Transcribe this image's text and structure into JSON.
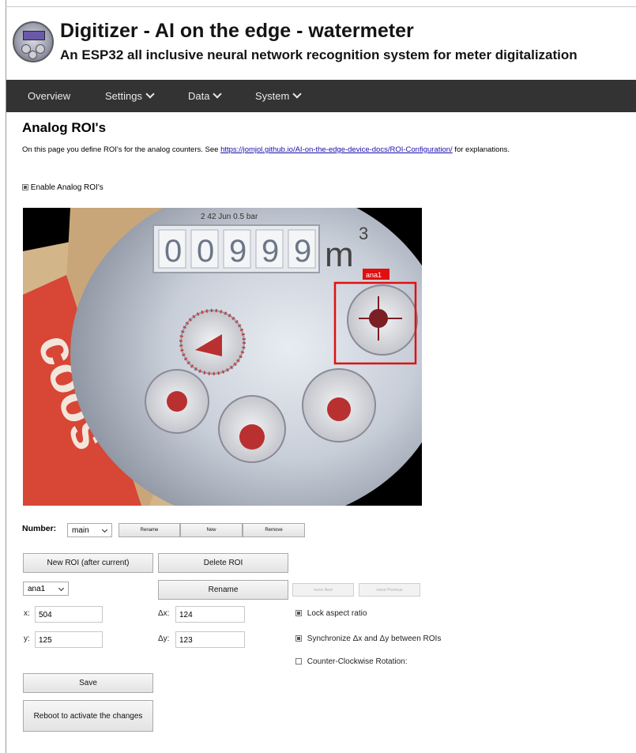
{
  "header": {
    "title": "Digitizer - AI on the edge - watermeter",
    "subtitle": "An ESP32 all inclusive neural network recognition system for meter digitalization"
  },
  "nav": {
    "overview": "Overview",
    "settings": "Settings",
    "data": "Data",
    "system": "System"
  },
  "page": {
    "title": "Analog ROI's",
    "intro_before": "On this page you define ROI's for the analog counters. See ",
    "intro_link": "https://jomjol.github.io/AI-on-the-edge-device-docs/ROI-Configuration/",
    "intro_after": " for explanations.",
    "enable_label": "Enable Analog ROI's",
    "enable_checked": true
  },
  "camera": {
    "digits": [
      "0",
      "0",
      "9",
      "9",
      "9"
    ],
    "unit": "m",
    "unit_exp": "3",
    "top_marks": "2  42  Jun  0.5 bar",
    "roi_label": "ana1",
    "roi_color": "#e01010"
  },
  "number_row": {
    "label": "Number:",
    "selected": "main",
    "rename": "Rename",
    "new": "New",
    "remove": "Remove"
  },
  "roi": {
    "new_roi": "New ROI (after current)",
    "delete_roi": "Delete ROI",
    "selected": "ana1",
    "rename": "Rename",
    "move_next": "move Next",
    "move_previous": "move Previous",
    "x_label": "x:",
    "x_value": "504",
    "y_label": "y:",
    "y_value": "125",
    "dx_label": "Δx:",
    "dx_value": "124",
    "dy_label": "Δy:",
    "dy_value": "123",
    "lock_aspect": "Lock aspect ratio",
    "lock_checked": true,
    "sync": "Synchronize Δx and Δy between ROIs",
    "sync_checked": true,
    "ccw": "Counter-Clockwise Rotation:",
    "ccw_checked": false
  },
  "actions": {
    "save": "Save",
    "reboot": "Reboot to activate the changes"
  }
}
